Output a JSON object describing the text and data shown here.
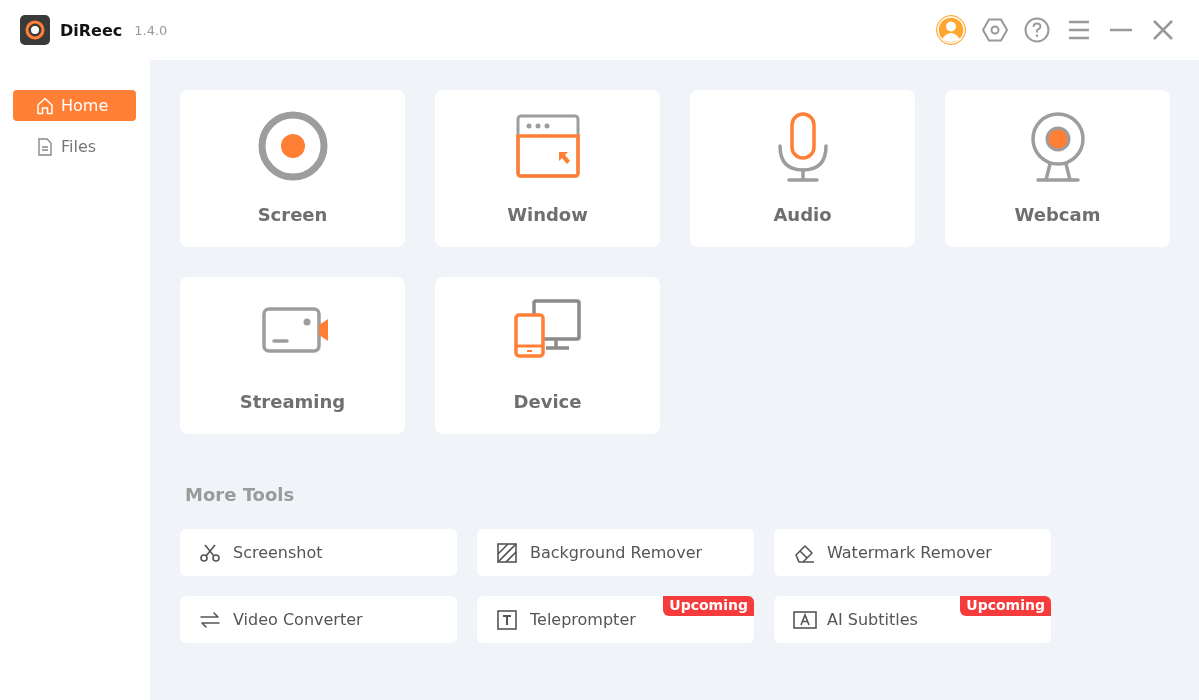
{
  "app": {
    "name": "DiReec",
    "version": "1.4.0"
  },
  "sidebar": {
    "items": [
      {
        "label": "Home",
        "kind": "home",
        "selected": true
      },
      {
        "label": "Files",
        "kind": "file",
        "selected": false
      }
    ]
  },
  "modes": [
    {
      "label": "Screen",
      "kind": "screen"
    },
    {
      "label": "Window",
      "kind": "window"
    },
    {
      "label": "Audio",
      "kind": "audio"
    },
    {
      "label": "Webcam",
      "kind": "webcam"
    },
    {
      "label": "Streaming",
      "kind": "streaming"
    },
    {
      "label": "Device",
      "kind": "device"
    }
  ],
  "more_tools": {
    "title": "More Tools",
    "items": [
      {
        "label": "Screenshot",
        "kind": "scissors"
      },
      {
        "label": "Background Remover",
        "kind": "hatch"
      },
      {
        "label": "Watermark Remover",
        "kind": "eraser"
      },
      {
        "label": "Video Converter",
        "kind": "arrows"
      },
      {
        "label": "Teleprompter",
        "kind": "t-box",
        "badge": "Upcoming"
      },
      {
        "label": "AI Subtitles",
        "kind": "a-box",
        "badge": "Upcoming"
      }
    ]
  }
}
